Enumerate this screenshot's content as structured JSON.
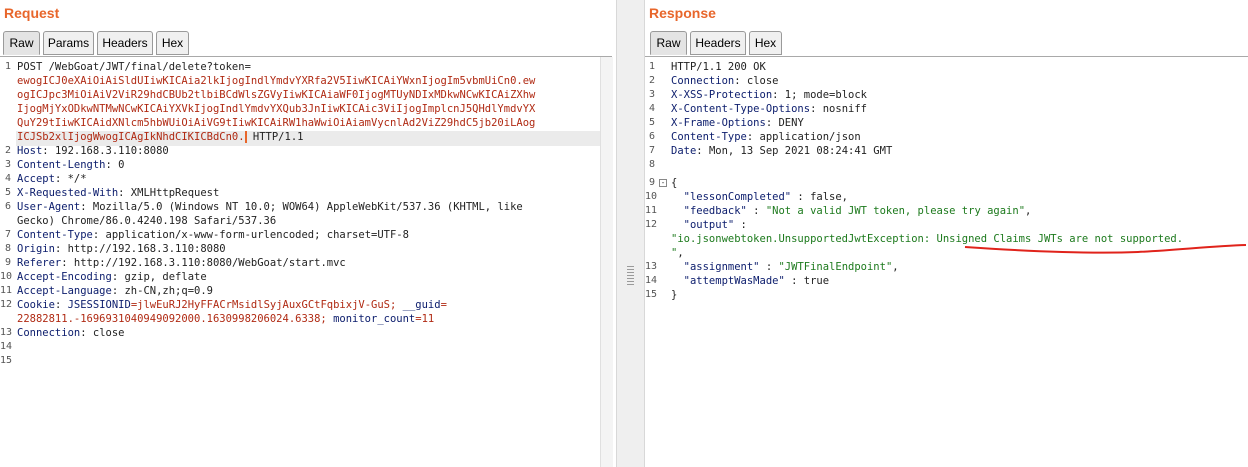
{
  "request": {
    "title": "Request",
    "tabs": [
      "Raw",
      "Params",
      "Headers",
      "Hex"
    ],
    "line_numbers": [
      "1",
      "2",
      "3",
      "4",
      "5",
      "6",
      "7",
      "8",
      "9",
      "10",
      "11",
      "12",
      "13",
      "14",
      "15"
    ],
    "line1_prefix": "POST /WebGoat/JWT/final/delete?token=",
    "token_lines": [
      "ewogICJ0eXAiOiAiSldUIiwKICAia2lkIjogIndlYmdvYXRfa2V5IiwKICAiYWxnIjogIm5vbmUiCn0.ew",
      "ogICJpc3MiOiAiV2ViR29hdCBUb2tlbiBCdWlsZGVyIiwKICAiaWF0IjogMTUyNDIxMDkwNCwKICAiZXhw",
      "IjogMjYxODkwNTMwNCwKICAiYXVkIjogIndlYmdvYXQub3JnIiwKICAic3ViIjogImplcnJ5QHdlYmdvYX",
      "QuY29tIiwKICAidXNlcm5hbWUiOiAiVG9tIiwKICAiRW1haWwiOiAiamVycnlAd2ViZ29hdC5jb20iLAog",
      "ICJSb2xlIjogWwogICAgIkNhdCIKICBdCn0."
    ],
    "line1_suffix": " HTTP/1.1",
    "headers": [
      {
        "name": "Host",
        "value": " 192.168.3.110:8080"
      },
      {
        "name": "Content-Length",
        "value": " 0"
      },
      {
        "name": "Accept",
        "value": " */*"
      },
      {
        "name": "X-Requested-With",
        "value": " XMLHttpRequest"
      },
      {
        "name": "User-Agent",
        "value": " Mozilla/5.0 (Windows NT 10.0; WOW64) AppleWebKit/537.36 (KHTML, like",
        "cont": "Gecko) Chrome/86.0.4240.198 Safari/537.36"
      },
      {
        "name": "Content-Type",
        "value": " application/x-www-form-urlencoded; charset=UTF-8"
      },
      {
        "name": "Origin",
        "value": " http://192.168.3.110:8080"
      },
      {
        "name": "Referer",
        "value": " http://192.168.3.110:8080/WebGoat/start.mvc"
      },
      {
        "name": "Accept-Encoding",
        "value": " gzip, deflate"
      },
      {
        "name": "Accept-Language",
        "value": " zh-CN,zh;q=0.9"
      },
      {
        "name": "Connection",
        "value": " close"
      }
    ],
    "cookie": {
      "name": "Cookie",
      "jsess_name": " JSESSIONID",
      "jsess_value": "=jlwEuRJ2HyFFACrMsidlSyjAuxGCtFqbixjV-GuS; ",
      "guid_name": "__guid",
      "guid_value": "=",
      "cont_value": "22882811.-1696931040949092000.1630998206024.6338; ",
      "mc_name": "monitor_count",
      "mc_value": "=11"
    }
  },
  "response": {
    "title": "Response",
    "tabs": [
      "Raw",
      "Headers",
      "Hex"
    ],
    "line_numbers": [
      "1",
      "2",
      "3",
      "4",
      "5",
      "6",
      "7",
      "8",
      "9",
      "10",
      "11",
      "12",
      "",
      "13",
      "14",
      "15"
    ],
    "status_line": "HTTP/1.1 200 OK",
    "headers": [
      {
        "name": "Connection",
        "value": " close"
      },
      {
        "name": "X-XSS-Protection",
        "value": " 1; mode=block"
      },
      {
        "name": "X-Content-Type-Options",
        "value": " nosniff"
      },
      {
        "name": "X-Frame-Options",
        "value": " DENY"
      },
      {
        "name": "Content-Type",
        "value": " application/json"
      },
      {
        "name": "Date",
        "value": " Mon, 13 Sep 2021 08:24:41 GMT"
      }
    ],
    "json": {
      "open": "{",
      "lessonCompleted_key": "  \"lessonCompleted\"",
      "lessonCompleted_val": " : false,",
      "feedback_key": "  \"feedback\"",
      "feedback_sep": " : ",
      "feedback_val": "\"Not a valid JWT token, please try again\"",
      "feedback_end": ",",
      "output_key": "  \"output\"",
      "output_sep": " :",
      "output_val": "\"io.jsonwebtoken.UnsupportedJwtException: Unsigned Claims JWTs are not supported.",
      "output_val_end": "\"",
      "output_end": ",",
      "assignment_key": "  \"assignment\"",
      "assignment_sep": " : ",
      "assignment_val": "\"JWTFinalEndpoint\"",
      "assignment_end": ",",
      "attempt_key": "  \"attemptWasMade\"",
      "attempt_val": " : true",
      "close": "}"
    }
  },
  "colors": {
    "accent": "#e8662b",
    "header_name": "#0b1c6c",
    "param_value": "#b02a13",
    "json_string": "#1d7a1d",
    "annotation": "#e0231b"
  }
}
